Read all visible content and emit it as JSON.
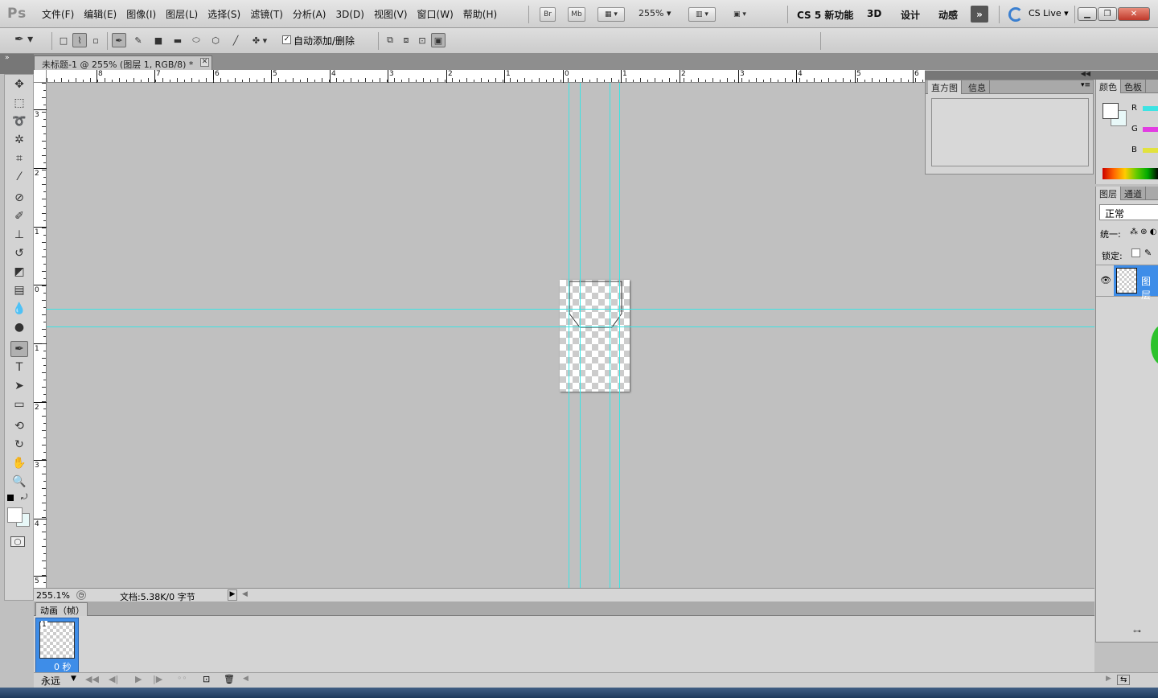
{
  "app": {
    "logo": "Ps"
  },
  "menus": [
    "文件(F)",
    "编辑(E)",
    "图像(I)",
    "图层(L)",
    "选择(S)",
    "滤镜(T)",
    "分析(A)",
    "3D(D)",
    "视图(V)",
    "窗口(W)",
    "帮助(H)"
  ],
  "appbar": {
    "br": "Br",
    "mb": "Mb",
    "zoom": "255%"
  },
  "workspaces": [
    "CS 5 新功能",
    "3D",
    "设计",
    "动感"
  ],
  "cs_live": "CS Live",
  "options": {
    "auto_add_delete": "自动添加/删除",
    "auto_add_delete_checked": true
  },
  "document": {
    "tab_title": "未标题-1 @ 255% (图层 1, RGB/8) *"
  },
  "ruler": {
    "top_labels": [
      "8",
      "7",
      "6",
      "5",
      "4",
      "3",
      "2",
      "1",
      "0",
      "1",
      "2",
      "3",
      "4",
      "5",
      "6"
    ],
    "left_labels": [
      "3",
      "2",
      "1",
      "0",
      "1",
      "2",
      "3",
      "4",
      "5"
    ]
  },
  "status": {
    "zoom": "255.1%",
    "doc_info": "文档:5.38K/0 字节"
  },
  "animation": {
    "tab": "动画（帧）",
    "frame_number": "1",
    "frame_delay": "0 秒",
    "loop": "永远"
  },
  "histogram_panel": {
    "tabs": [
      "直方图",
      "信息"
    ]
  },
  "color_panel": {
    "tabs": [
      "颜色",
      "色板"
    ],
    "channels": [
      "R",
      "G",
      "B"
    ]
  },
  "layers_panel": {
    "tabs": [
      "图层",
      "通道"
    ],
    "blend_mode": "正常",
    "unify_label": "统一:",
    "lock_label": "锁定:",
    "layer_name": "图层"
  },
  "colors": {
    "guide": "#3de3e3",
    "selection": "#3e8de8",
    "canvas_bg": "#c0c0c0"
  }
}
